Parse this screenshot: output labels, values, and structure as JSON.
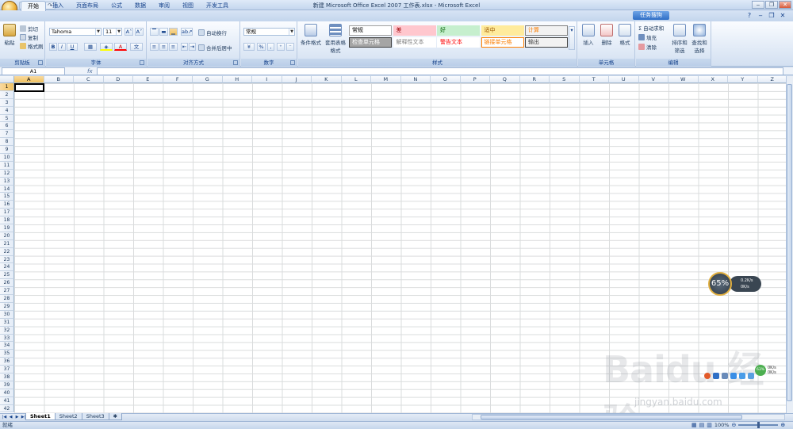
{
  "window": {
    "title": "新建 Microsoft Office Excel 2007 工作表.xlsx - Microsoft Excel",
    "controls": [
      "‒",
      "❐",
      "✕"
    ]
  },
  "quick_access": [
    "💾",
    "↶",
    "↷"
  ],
  "tabs": [
    "开始",
    "插入",
    "页面布局",
    "公式",
    "数据",
    "审阅",
    "视图",
    "开发工具"
  ],
  "active_tab": "开始",
  "sogou_badge": "任务搜狗",
  "ribbon": {
    "clipboard": {
      "paste": "粘贴",
      "cut": "剪切",
      "copy": "复制",
      "format_painter": "格式刷",
      "label": "剪贴板"
    },
    "font": {
      "name": "Tahoma",
      "size": "11",
      "bold": "B",
      "italic": "I",
      "underline": "U",
      "grow": "A˄",
      "shrink": "A˅",
      "label": "字体"
    },
    "alignment": {
      "wrap": "自动换行",
      "merge": "合并后居中",
      "label": "对齐方式"
    },
    "number": {
      "format": "常规",
      "percent": "%",
      "comma": ",",
      "label": "数字"
    },
    "styles": {
      "conditional": "条件格式",
      "table": "套用表格格式",
      "cells": [
        {
          "text": "常规",
          "bg": "#ffffff",
          "color": "#000000",
          "border": "#a0a0a0"
        },
        {
          "text": "差",
          "bg": "#ffc7ce",
          "color": "#9c0006",
          "border": "#ffc7ce"
        },
        {
          "text": "好",
          "bg": "#c6efce",
          "color": "#006100",
          "border": "#c6efce"
        },
        {
          "text": "适中",
          "bg": "#ffeb9c",
          "color": "#9c5700",
          "border": "#ffeb9c"
        },
        {
          "text": "计算",
          "bg": "#f2f2f2",
          "color": "#fa7d00",
          "border": "#7f7f7f"
        },
        {
          "text": "检查单元格",
          "bg": "#a5a5a5",
          "color": "#ffffff",
          "border": "#3f3f3f"
        },
        {
          "text": "解释性文本",
          "bg": "#ffffff",
          "color": "#7f7f7f",
          "border": "#ffffff"
        },
        {
          "text": "警告文本",
          "bg": "#ffffff",
          "color": "#ff0000",
          "border": "#ffffff"
        },
        {
          "text": "链接单元格",
          "bg": "#ffffff",
          "color": "#fa7d00",
          "border": "#ff8001"
        },
        {
          "text": "输出",
          "bg": "#f2f2f2",
          "color": "#3f3f3f",
          "border": "#3f3f3f"
        }
      ],
      "label": "样式"
    },
    "cells_group": {
      "insert": "插入",
      "delete": "删除",
      "format": "格式",
      "label": "单元格"
    },
    "editing": {
      "autosum": "Σ 自动求和",
      "fill": "填充",
      "clear": "清除",
      "sort": "排序和筛选",
      "find": "查找和选择",
      "label": "编辑"
    }
  },
  "namebox": "A1",
  "fx": "fx",
  "columns": [
    "A",
    "B",
    "C",
    "D",
    "E",
    "F",
    "G",
    "H",
    "I",
    "J",
    "K",
    "L",
    "M",
    "N",
    "O",
    "P",
    "Q",
    "R",
    "S",
    "T",
    "U",
    "V",
    "W",
    "X",
    "Y",
    "Z"
  ],
  "rows": [
    "1",
    "2",
    "3",
    "4",
    "5",
    "6",
    "7",
    "8",
    "9",
    "10",
    "11",
    "12",
    "13",
    "14",
    "15",
    "16",
    "17",
    "18",
    "19",
    "20",
    "21",
    "22",
    "23",
    "24",
    "25",
    "26",
    "27",
    "28",
    "29",
    "30",
    "31",
    "32",
    "33",
    "34",
    "35",
    "36",
    "37",
    "38",
    "39",
    "40",
    "41",
    "42"
  ],
  "sheets": [
    "Sheet1",
    "Sheet2",
    "Sheet3"
  ],
  "active_sheet": "Sheet1",
  "status": {
    "text": "就绪",
    "zoom": "100%"
  },
  "widget": {
    "percent": "65%",
    "up": "0.2K/s",
    "down": "0K/s"
  },
  "net_widget": {
    "percent": "63%",
    "up": "0K/s",
    "down": "0K/s"
  },
  "watermark": {
    "brand": "Baidu 经验",
    "url": "jingyan.baidu.com"
  }
}
